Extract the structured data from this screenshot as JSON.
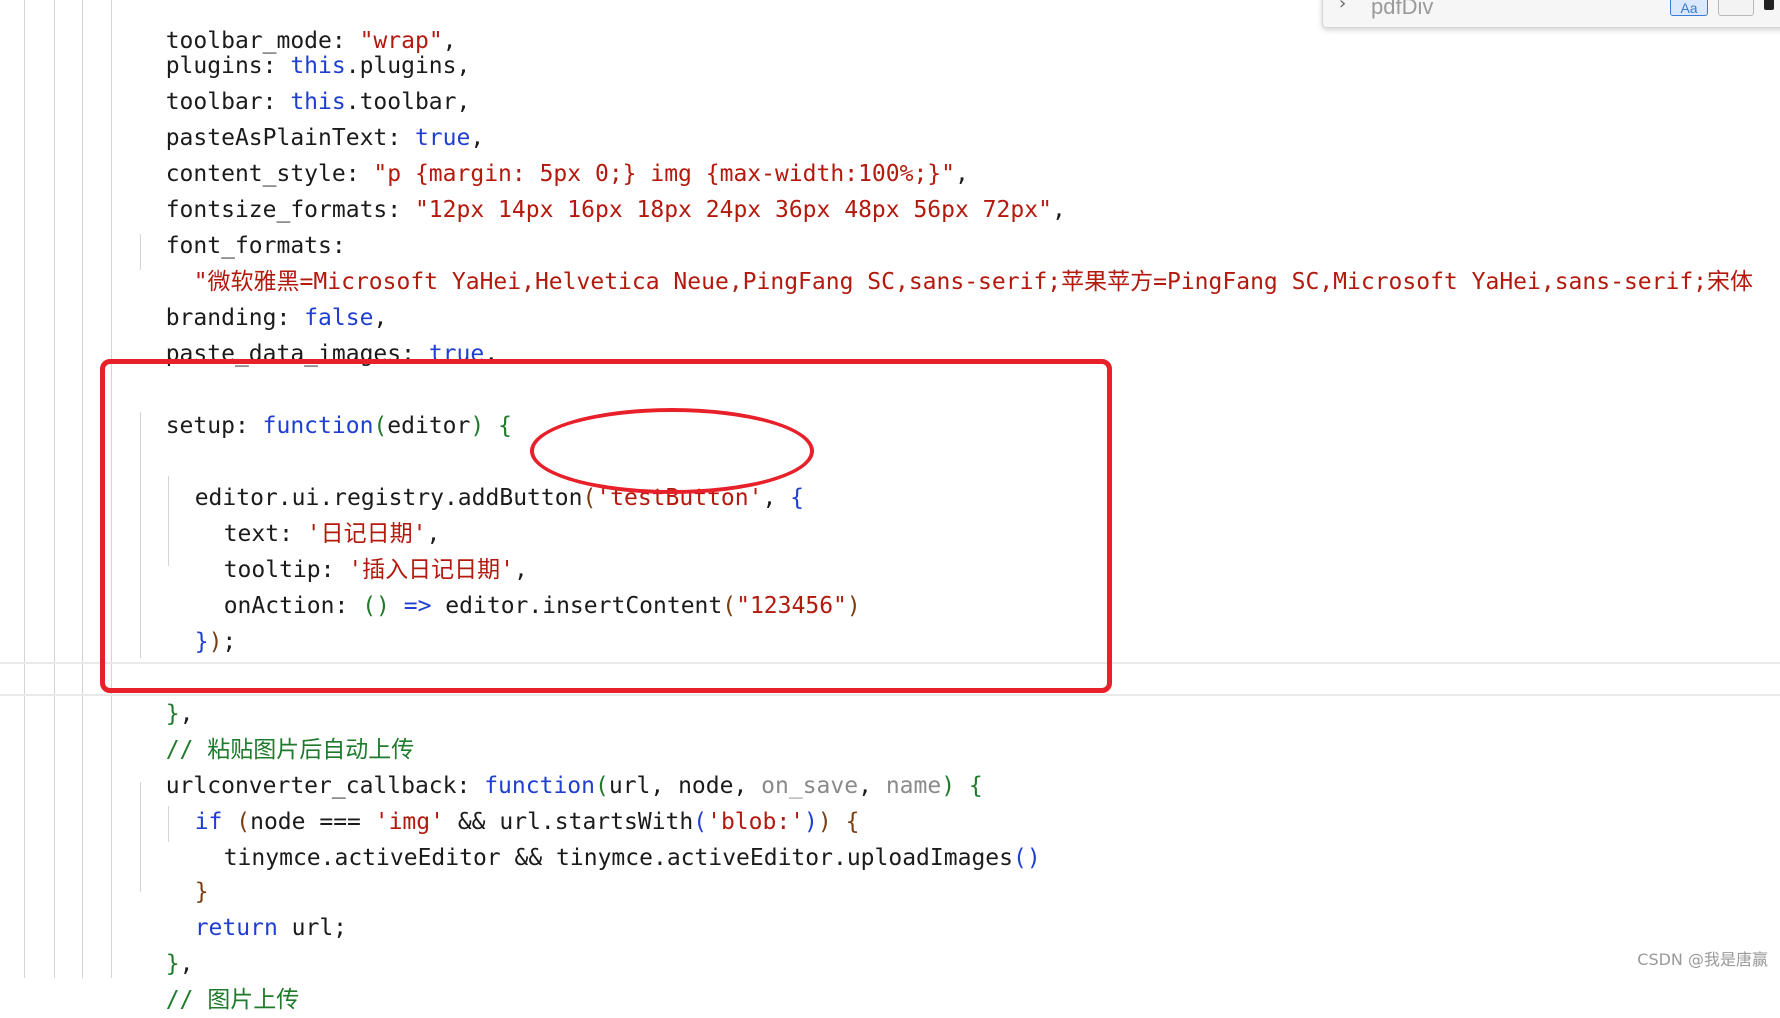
{
  "search": {
    "value": "pdfDiv",
    "case_label": "Aa"
  },
  "watermark": "CSDN @我是唐赢",
  "code": {
    "l0": {
      "a": "toolbar_mode",
      "b": ": ",
      "c": "\"wrap\"",
      "d": ","
    },
    "l1": {
      "a": "plugins: ",
      "b": "this",
      "c": ".plugins,"
    },
    "l2": {
      "a": "toolbar: ",
      "b": "this",
      "c": ".toolbar,"
    },
    "l3": {
      "a": "pasteAsPlainText: ",
      "b": "true",
      "c": ","
    },
    "l4": {
      "a": "content_style: ",
      "b": "\"p {margin: 5px 0;} img {max-width:100%;}\"",
      "c": ","
    },
    "l5": {
      "a": "fontsize_formats: ",
      "b": "\"12px 14px 16px 18px 24px 36px 48px 56px 72px\"",
      "c": ","
    },
    "l6": {
      "a": "font_formats:"
    },
    "l7": {
      "b": "\"微软雅黑=Microsoft YaHei,Helvetica Neue,PingFang SC,sans-serif;苹果苹方=PingFang SC,Microsoft YaHei,sans-serif;宋体"
    },
    "l8": {
      "a": "branding: ",
      "b": "false",
      "c": ","
    },
    "l9": {
      "a": "paste_data_images: ",
      "b": "true",
      "c": ","
    },
    "l11": {
      "a": "setup: ",
      "b": "function",
      "c": "(",
      "d": "editor",
      "e": ")",
      "f": " ",
      "g": "{"
    },
    "l13": {
      "a": "editor.ui.registry.addButton",
      "b": "(",
      "c": "'testButton'",
      "d": ", ",
      "e": "{"
    },
    "l14": {
      "a": "text: ",
      "b": "'日记日期'",
      "c": ","
    },
    "l15": {
      "a": "tooltip: ",
      "b": "'插入日记日期'",
      "c": ","
    },
    "l16": {
      "a": "onAction: ",
      "b": "()",
      "c": " ",
      "d": "=>",
      "e": " editor.insertContent",
      "f": "(",
      "g": "\"123456\"",
      "h": ")"
    },
    "l17": {
      "a": "}",
      "b": ")",
      "c": ";"
    },
    "l19": {
      "a": "}",
      "b": ","
    },
    "l20": {
      "a": "// 粘贴图片后自动上传"
    },
    "l21": {
      "a": "urlconverter_callback: ",
      "b": "function",
      "c": "(",
      "d": "url, node, ",
      "e": "on_save",
      "f": ", ",
      "g": "name",
      "h": ")",
      "i": " {"
    },
    "l22": {
      "a": "if",
      "b": " (",
      "c": "node === ",
      "d": "'img'",
      "e": " && url.startsWith",
      "f": "(",
      "g": "'blob:'",
      "h": ")",
      "i": ")",
      "j": " {"
    },
    "l23": {
      "a": "tinymce.activeEditor && tinymce.activeEditor.uploadImages",
      "b": "()"
    },
    "l24": {
      "a": "}"
    },
    "l25": {
      "a": "return",
      "b": " url;"
    },
    "l26": {
      "a": "}",
      "b": ","
    },
    "l27": {
      "a": "// 图片上传"
    }
  }
}
